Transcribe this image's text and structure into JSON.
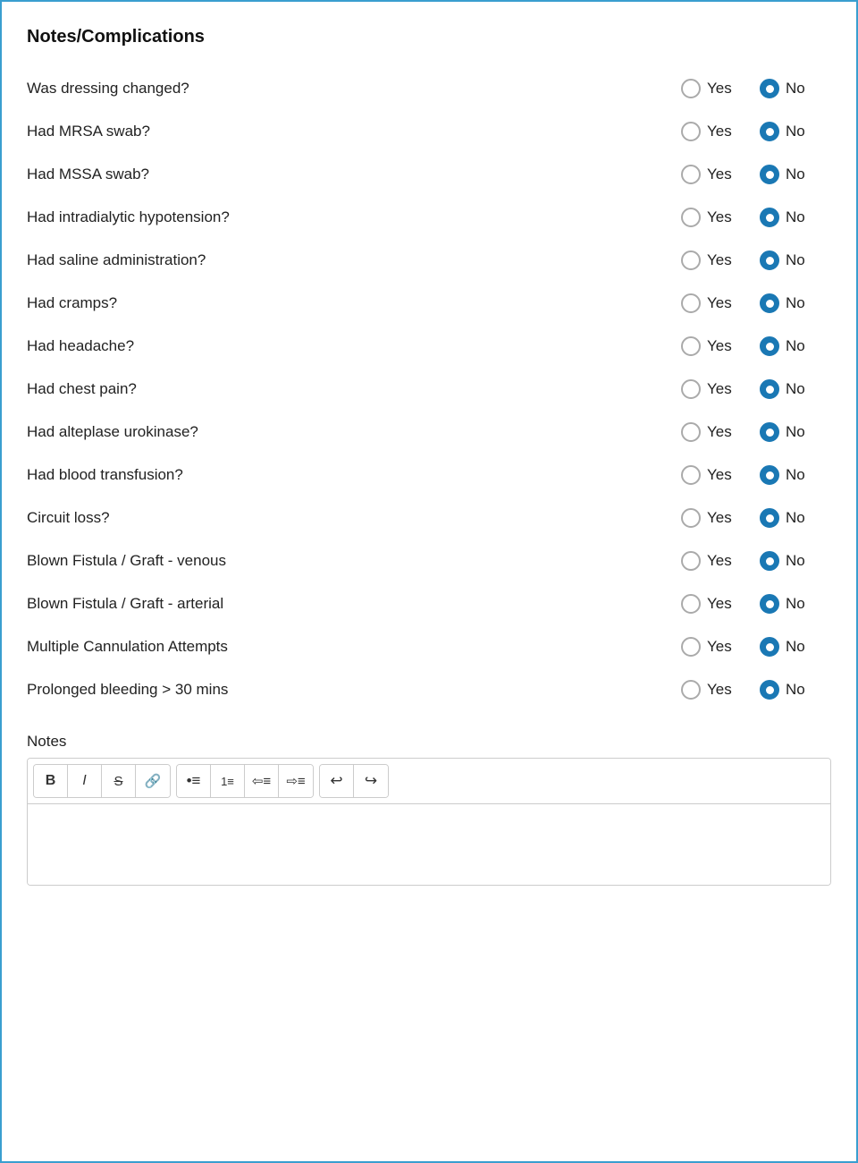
{
  "page": {
    "title": "Notes/Complications",
    "accent_color": "#3a9ecf",
    "questions": [
      {
        "id": "dressing",
        "label": "Was dressing changed?",
        "selected": "no"
      },
      {
        "id": "mrsa",
        "label": "Had MRSA swab?",
        "selected": "no"
      },
      {
        "id": "mssa",
        "label": "Had MSSA swab?",
        "selected": "no"
      },
      {
        "id": "hypotension",
        "label": "Had intradialytic hypotension?",
        "selected": "no"
      },
      {
        "id": "saline",
        "label": "Had saline administration?",
        "selected": "no"
      },
      {
        "id": "cramps",
        "label": "Had cramps?",
        "selected": "no"
      },
      {
        "id": "headache",
        "label": "Had headache?",
        "selected": "no"
      },
      {
        "id": "chest_pain",
        "label": "Had chest pain?",
        "selected": "no"
      },
      {
        "id": "alteplase",
        "label": "Had alteplase urokinase?",
        "selected": "no"
      },
      {
        "id": "blood_transfusion",
        "label": "Had blood transfusion?",
        "selected": "no"
      },
      {
        "id": "circuit_loss",
        "label": "Circuit loss?",
        "selected": "no"
      },
      {
        "id": "blown_venous",
        "label": "Blown Fistula / Graft - venous",
        "selected": "no"
      },
      {
        "id": "blown_arterial",
        "label": "Blown Fistula / Graft - arterial",
        "selected": "no"
      },
      {
        "id": "cannulation",
        "label": "Multiple Cannulation Attempts",
        "selected": "no"
      },
      {
        "id": "prolonged_bleeding",
        "label": "Prolonged bleeding > 30 mins",
        "selected": "no"
      }
    ],
    "yes_label": "Yes",
    "no_label": "No",
    "notes_label": "Notes",
    "toolbar": {
      "bold": "B",
      "italic": "I",
      "strikethrough": "S",
      "link": "🔗",
      "bullet_list": "ul",
      "ordered_list": "ol",
      "outdent": "outdent",
      "indent": "indent",
      "undo": "undo",
      "redo": "redo"
    }
  }
}
